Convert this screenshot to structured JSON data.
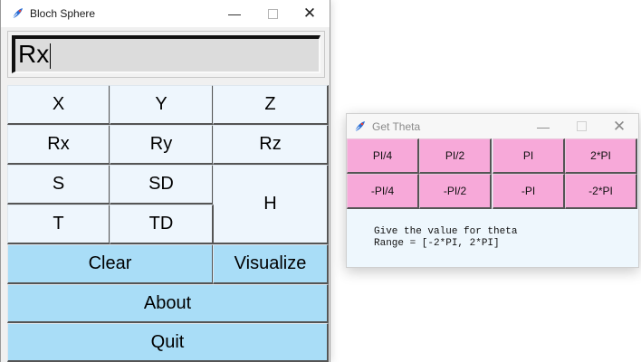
{
  "main_window": {
    "title": "Bloch Sphere",
    "entry_value": "Rx",
    "buttons": {
      "x": "X",
      "y": "Y",
      "z": "Z",
      "rx": "Rx",
      "ry": "Ry",
      "rz": "Rz",
      "s": "S",
      "sd": "SD",
      "h": "H",
      "t": "T",
      "td": "TD",
      "clear": "Clear",
      "visualize": "Visualize",
      "about": "About",
      "quit": "Quit"
    }
  },
  "theta_window": {
    "title": "Get Theta",
    "buttons": [
      "PI/4",
      "PI/2",
      "PI",
      "2*PI",
      "-PI/4",
      "-PI/2",
      "-PI",
      "-2*PI"
    ],
    "message_line1": "Give the value for theta",
    "message_line2": "Range = [-2*PI, 2*PI]"
  },
  "window_controls": {
    "minimize": "—",
    "close": "✕"
  },
  "colors": {
    "gate_button": "#eef6fd",
    "action_button": "#a9ddf7",
    "theta_button": "#f7a9d9",
    "theta_background": "#eef7fd"
  },
  "icons": [
    "feather-app-icon",
    "minimize-icon",
    "maximize-icon",
    "close-icon"
  ]
}
